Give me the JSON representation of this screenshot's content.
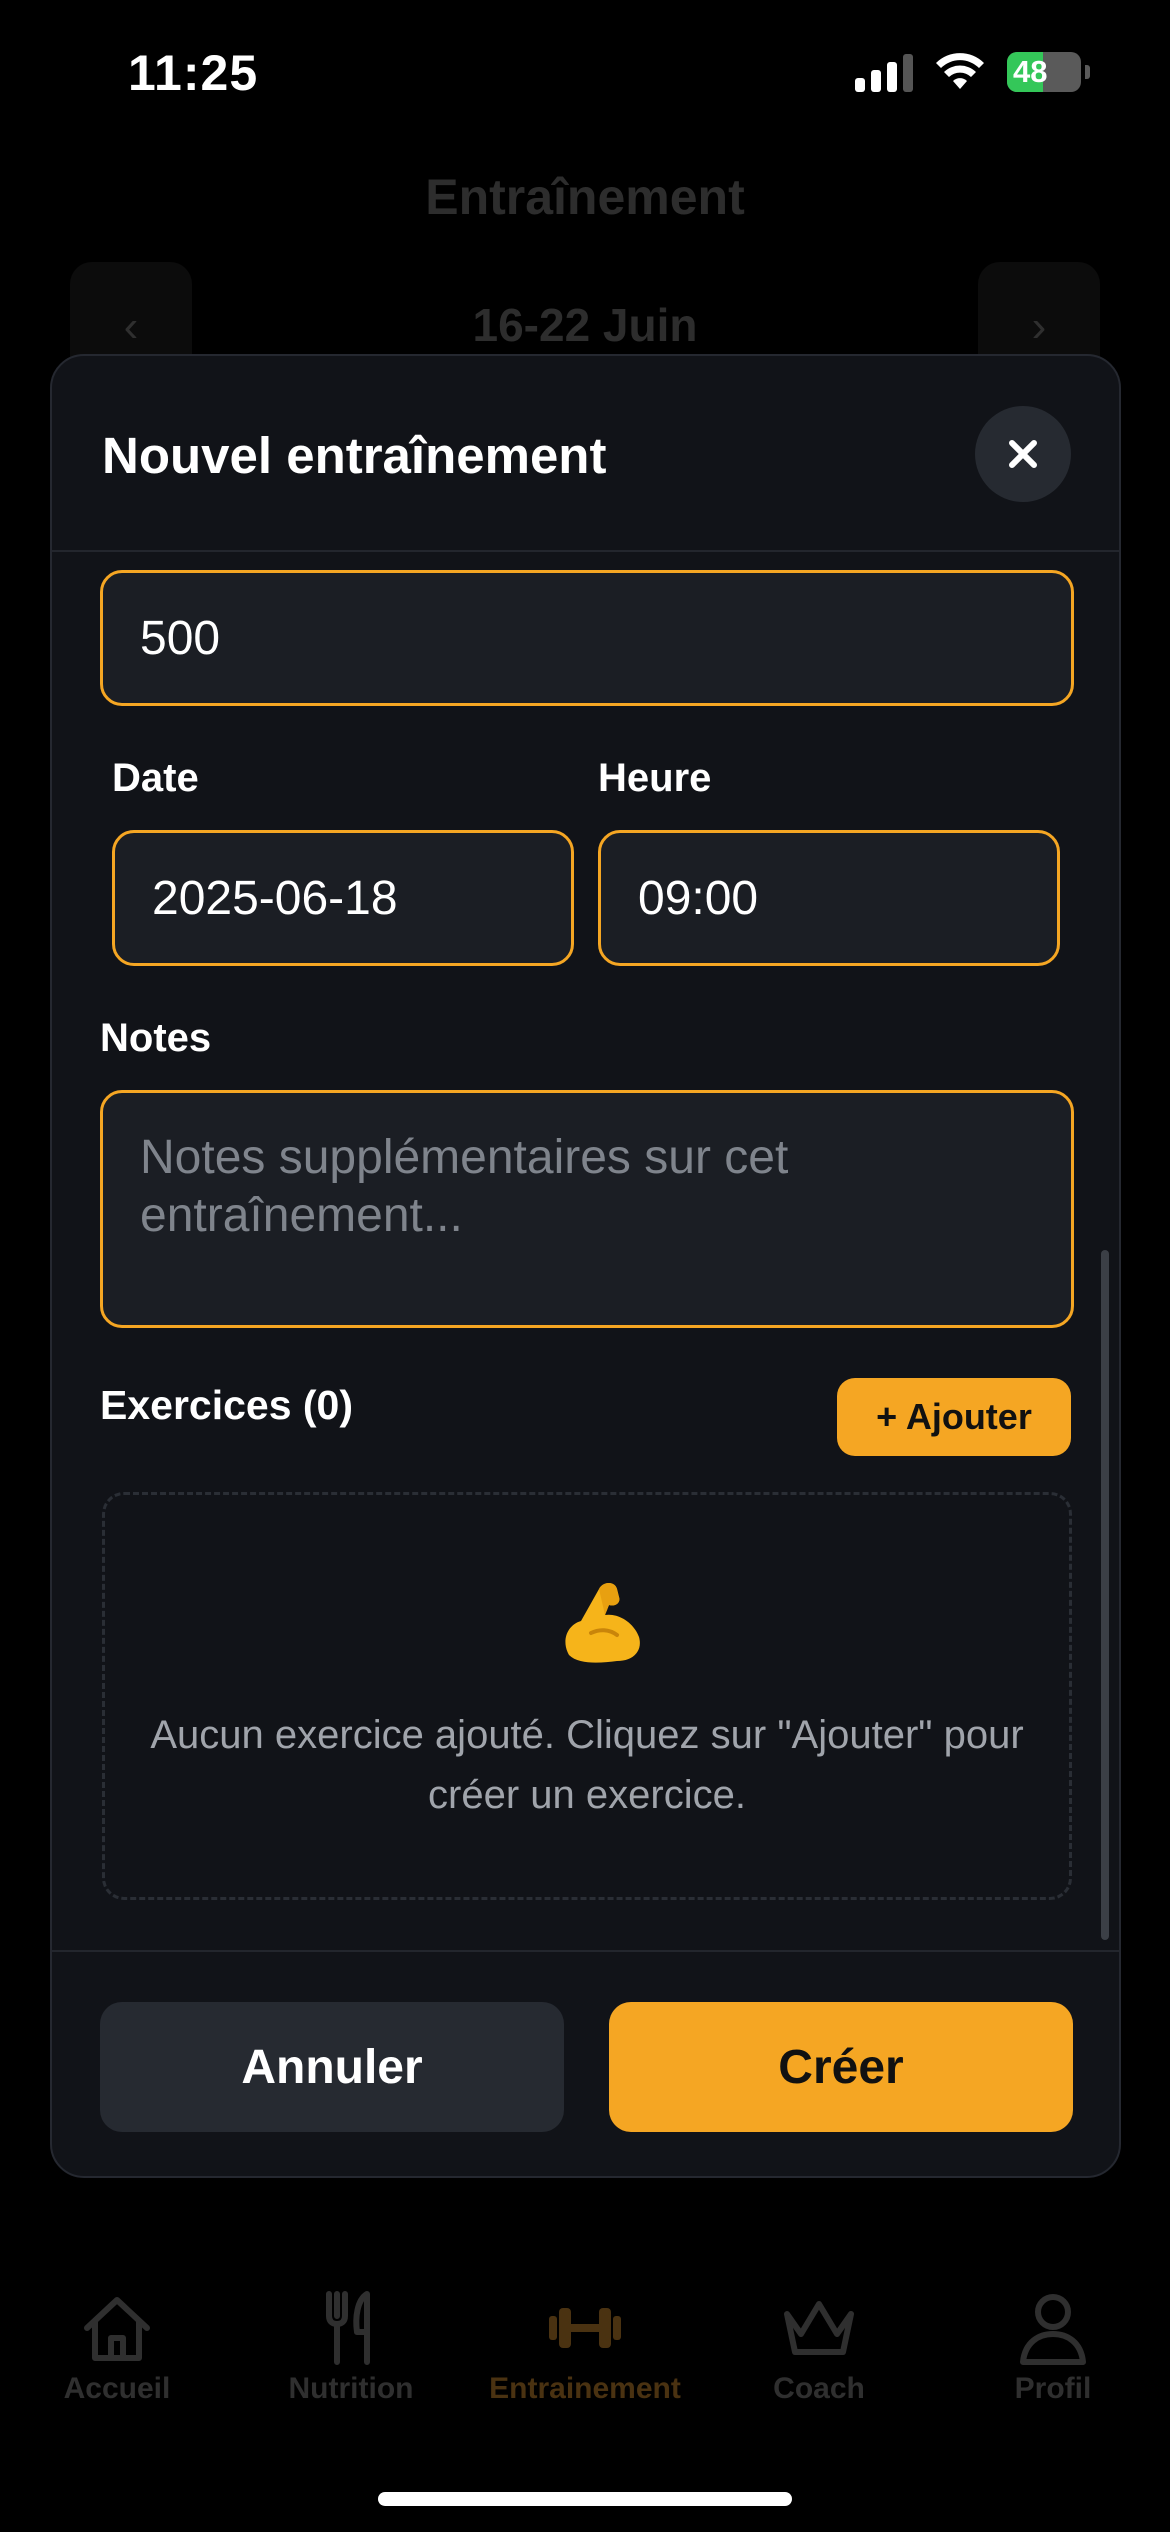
{
  "status_bar": {
    "time": "11:25",
    "battery": "48"
  },
  "background": {
    "title": "Entraînement",
    "week": {
      "prev": "‹",
      "label": "16-22 Juin",
      "next": "›"
    }
  },
  "modal": {
    "title": "Nouvel entraînement",
    "close_icon": "×",
    "calories": {
      "value": "500"
    },
    "date": {
      "label": "Date",
      "value": "2025-06-18"
    },
    "time": {
      "label": "Heure",
      "value": "09:00"
    },
    "notes": {
      "label": "Notes",
      "placeholder": "Notes supplémentaires sur cet entraînement..."
    },
    "exercises": {
      "label": "Exercices (0)",
      "add_button": "+ Ajouter",
      "empty_icon": "💪",
      "empty_text": "Aucun exercice ajouté. Cliquez sur \"Ajouter\" pour créer un exercice."
    },
    "cancel_button": "Annuler",
    "create_button": "Créer"
  },
  "tabbar": {
    "items": [
      {
        "label": "Accueil",
        "icon": "home-icon"
      },
      {
        "label": "Nutrition",
        "icon": "fork-knife-icon"
      },
      {
        "label": "Entrainement",
        "icon": "dumbbell-icon",
        "active": true
      },
      {
        "label": "Coach",
        "icon": "crown-icon"
      },
      {
        "label": "Profil",
        "icon": "user-icon"
      }
    ]
  },
  "colors": {
    "accent": "#f5a623",
    "modal_bg": "#111318",
    "field_bg": "#1b1e24"
  }
}
